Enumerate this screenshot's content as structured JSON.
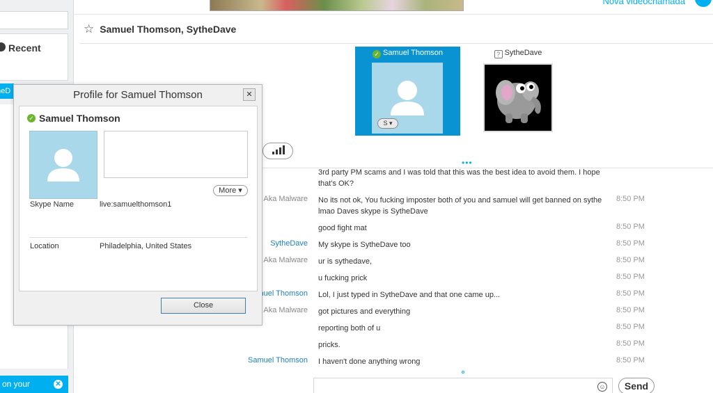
{
  "sidebar": {
    "recent_label": "Recent",
    "selected_partial": "theD",
    "notice_partial": "on your"
  },
  "header": {
    "top_link_partial": "Nova videochamada"
  },
  "conversation": {
    "title": "Samuel Thomson, SytheDave",
    "participants": [
      {
        "name": "Samuel Thomson",
        "status": "online",
        "active": true
      },
      {
        "name": "SytheDave",
        "status": "unknown",
        "active": false
      }
    ]
  },
  "messages": [
    {
      "sender": "",
      "sender_color": "gray",
      "text": "3rd party PM scams and I was told that this was the best idea to avoid them. I hope that's OK?",
      "time": ""
    },
    {
      "sender": "' Aka Malware",
      "sender_color": "gray",
      "text": "No its not ok, You fucking imposter both of you and samuel will get banned on sythe lmao Daves skype is SytheDave",
      "time": "8:50 PM"
    },
    {
      "sender": "",
      "sender_color": "gray",
      "text": "good fight mat",
      "time": "8:50 PM"
    },
    {
      "sender": "SytheDave",
      "sender_color": "blue",
      "text": "My skype is SytheDave too",
      "time": "8:50 PM"
    },
    {
      "sender": "' Aka Malware",
      "sender_color": "gray",
      "text": "ur is sythedave,",
      "time": "8:50 PM"
    },
    {
      "sender": "",
      "sender_color": "gray",
      "text": "u fucking prick",
      "time": "8:50 PM"
    },
    {
      "sender": "nuel Thomson",
      "sender_color": "blue",
      "text": "Lol, I just typed in SytheDave and that one came up...",
      "time": "8:50 PM"
    },
    {
      "sender": "' Aka Malware",
      "sender_color": "gray",
      "text": "got pictures and everything",
      "time": "8:50 PM"
    },
    {
      "sender": "",
      "sender_color": "gray",
      "text": "reporting both of u",
      "time": "8:50 PM"
    },
    {
      "sender": "",
      "sender_color": "gray",
      "text": "pricks.",
      "time": "8:50 PM"
    },
    {
      "sender": "Samuel Thomson",
      "sender_color": "blue",
      "text": "I haven't done anything wrong",
      "time": "8:50 PM"
    }
  ],
  "compose": {
    "send_label": "Send"
  },
  "profile_dialog": {
    "title": "Profile for Samuel Thomson",
    "name": "Samuel Thomson",
    "more_label": "More",
    "fields": [
      {
        "label": "Skype Name",
        "value": "live:samuelthomson1"
      },
      {
        "label": "Location",
        "value": "Philadelphia, United States"
      }
    ],
    "close_label": "Close"
  },
  "colors": {
    "accent": "#00aff0",
    "tile_active": "#0a93d2",
    "avatar_bg": "#a8d8ea",
    "online": "#6db42f",
    "sender_blue": "#1a7fc1"
  },
  "icons": [
    "clock-icon",
    "star-icon",
    "check-status-icon",
    "unknown-status-icon",
    "signal-icon",
    "smiley-icon",
    "close-icon",
    "chevron-down-icon"
  ]
}
